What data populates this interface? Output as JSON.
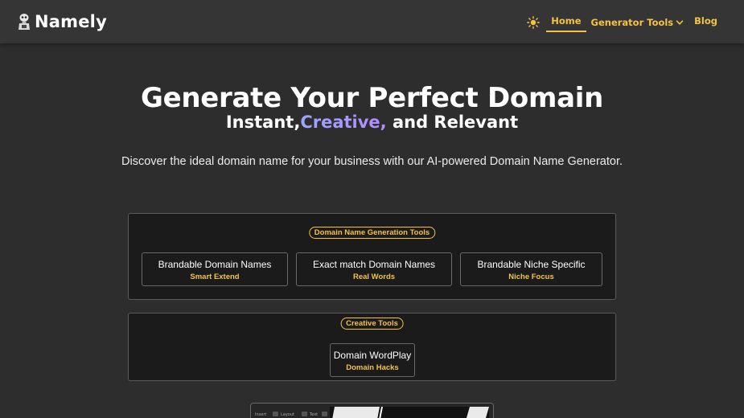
{
  "header": {
    "logo_text": "Namely",
    "nav": {
      "home": "Home",
      "generator_tools": "Generator Tools",
      "blog": "Blog"
    }
  },
  "hero": {
    "title": "Generate Your Perfect Domain",
    "subtitle_prefix": "Instant,",
    "subtitle_accent": "Creative,",
    "subtitle_suffix": "and Relevant",
    "description": "Discover the ideal domain name for your business with our AI-powered Domain Name Generator."
  },
  "sections": [
    {
      "title": "Domain Name Generation Tools",
      "tools": [
        {
          "title": "Brandable Domain Names",
          "subtitle": "Smart Extend"
        },
        {
          "title": "Exact match Domain Names",
          "subtitle": "Real Words"
        },
        {
          "title": "Brandable Niche Specific",
          "subtitle": "Niche Focus"
        }
      ]
    },
    {
      "title": "Creative Tools",
      "tools": [
        {
          "title": "Domain WordPlay",
          "subtitle": "Domain Hacks"
        }
      ]
    }
  ],
  "preview": {
    "toolbar": [
      "Insert",
      "Layout",
      "Text"
    ]
  },
  "colors": {
    "accent": "#f5c242",
    "background": "#2d2d2d",
    "header": "#353535",
    "panel": "#1b1b1b",
    "gradient_start": "#9aa5ff",
    "gradient_end": "#b48cff"
  }
}
